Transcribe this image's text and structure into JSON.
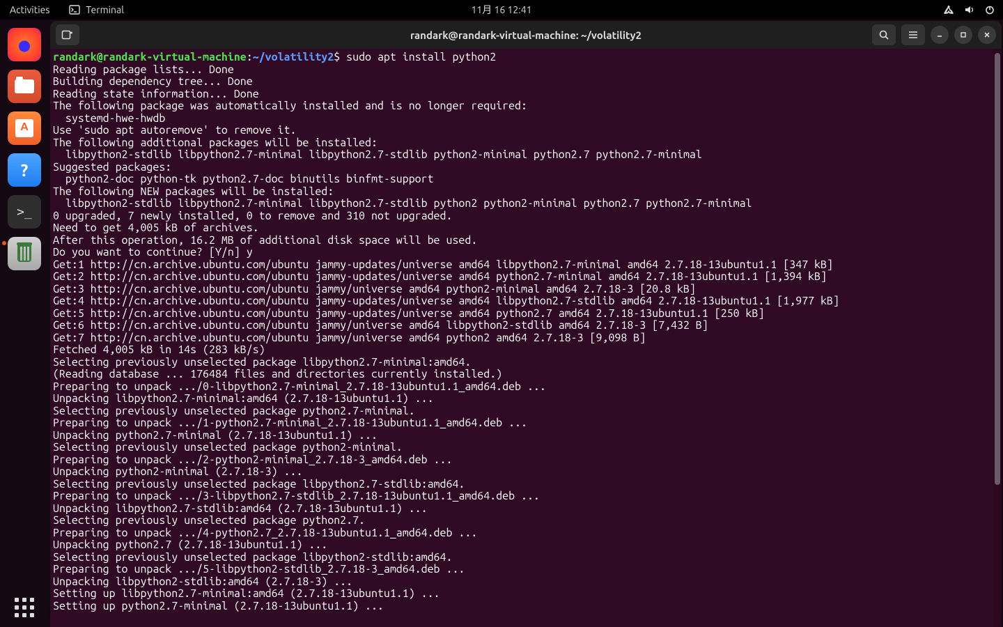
{
  "topbar": {
    "activities_label": "Activities",
    "app_label": "Terminal",
    "clock": "11月 16  12:41"
  },
  "dock": {
    "items": [
      {
        "name": "firefox-icon"
      },
      {
        "name": "files-icon"
      },
      {
        "name": "ubuntu-software-icon"
      },
      {
        "name": "help-icon"
      },
      {
        "name": "terminal-icon"
      },
      {
        "name": "trash-icon"
      }
    ]
  },
  "window": {
    "title": "randark@randark-virtual-machine: ~/volatility2"
  },
  "terminal": {
    "prompt_user_host": "randark@randark-virtual-machine",
    "prompt_sep": ":",
    "prompt_path": "~/volatility2",
    "prompt_sigil": "$",
    "command": "sudo apt install python2",
    "lines": [
      "Reading package lists... Done",
      "Building dependency tree... Done",
      "Reading state information... Done",
      "The following package was automatically installed and is no longer required:",
      "  systemd-hwe-hwdb",
      "Use 'sudo apt autoremove' to remove it.",
      "The following additional packages will be installed:",
      "  libpython2-stdlib libpython2.7-minimal libpython2.7-stdlib python2-minimal python2.7 python2.7-minimal",
      "Suggested packages:",
      "  python2-doc python-tk python2.7-doc binutils binfmt-support",
      "The following NEW packages will be installed:",
      "  libpython2-stdlib libpython2.7-minimal libpython2.7-stdlib python2 python2-minimal python2.7 python2.7-minimal",
      "0 upgraded, 7 newly installed, 0 to remove and 310 not upgraded.",
      "Need to get 4,005 kB of archives.",
      "After this operation, 16.2 MB of additional disk space will be used.",
      "Do you want to continue? [Y/n] y",
      "Get:1 http://cn.archive.ubuntu.com/ubuntu jammy-updates/universe amd64 libpython2.7-minimal amd64 2.7.18-13ubuntu1.1 [347 kB]",
      "Get:2 http://cn.archive.ubuntu.com/ubuntu jammy-updates/universe amd64 python2.7-minimal amd64 2.7.18-13ubuntu1.1 [1,394 kB]",
      "Get:3 http://cn.archive.ubuntu.com/ubuntu jammy/universe amd64 python2-minimal amd64 2.7.18-3 [20.8 kB]",
      "Get:4 http://cn.archive.ubuntu.com/ubuntu jammy-updates/universe amd64 libpython2.7-stdlib amd64 2.7.18-13ubuntu1.1 [1,977 kB]",
      "Get:5 http://cn.archive.ubuntu.com/ubuntu jammy-updates/universe amd64 python2.7 amd64 2.7.18-13ubuntu1.1 [250 kB]",
      "Get:6 http://cn.archive.ubuntu.com/ubuntu jammy/universe amd64 libpython2-stdlib amd64 2.7.18-3 [7,432 B]",
      "Get:7 http://cn.archive.ubuntu.com/ubuntu jammy/universe amd64 python2 amd64 2.7.18-3 [9,098 B]",
      "Fetched 4,005 kB in 14s (283 kB/s)",
      "Selecting previously unselected package libpython2.7-minimal:amd64.",
      "(Reading database ... 176484 files and directories currently installed.)",
      "Preparing to unpack .../0-libpython2.7-minimal_2.7.18-13ubuntu1.1_amd64.deb ...",
      "Unpacking libpython2.7-minimal:amd64 (2.7.18-13ubuntu1.1) ...",
      "Selecting previously unselected package python2.7-minimal.",
      "Preparing to unpack .../1-python2.7-minimal_2.7.18-13ubuntu1.1_amd64.deb ...",
      "Unpacking python2.7-minimal (2.7.18-13ubuntu1.1) ...",
      "Selecting previously unselected package python2-minimal.",
      "Preparing to unpack .../2-python2-minimal_2.7.18-3_amd64.deb ...",
      "Unpacking python2-minimal (2.7.18-3) ...",
      "Selecting previously unselected package libpython2.7-stdlib:amd64.",
      "Preparing to unpack .../3-libpython2.7-stdlib_2.7.18-13ubuntu1.1_amd64.deb ...",
      "Unpacking libpython2.7-stdlib:amd64 (2.7.18-13ubuntu1.1) ...",
      "Selecting previously unselected package python2.7.",
      "Preparing to unpack .../4-python2.7_2.7.18-13ubuntu1.1_amd64.deb ...",
      "Unpacking python2.7 (2.7.18-13ubuntu1.1) ...",
      "Selecting previously unselected package libpython2-stdlib:amd64.",
      "Preparing to unpack .../5-libpython2-stdlib_2.7.18-3_amd64.deb ...",
      "Unpacking libpython2-stdlib:amd64 (2.7.18-3) ...",
      "Setting up libpython2.7-minimal:amd64 (2.7.18-13ubuntu1.1) ...",
      "Setting up python2.7-minimal (2.7.18-13ubuntu1.1) ..."
    ]
  }
}
